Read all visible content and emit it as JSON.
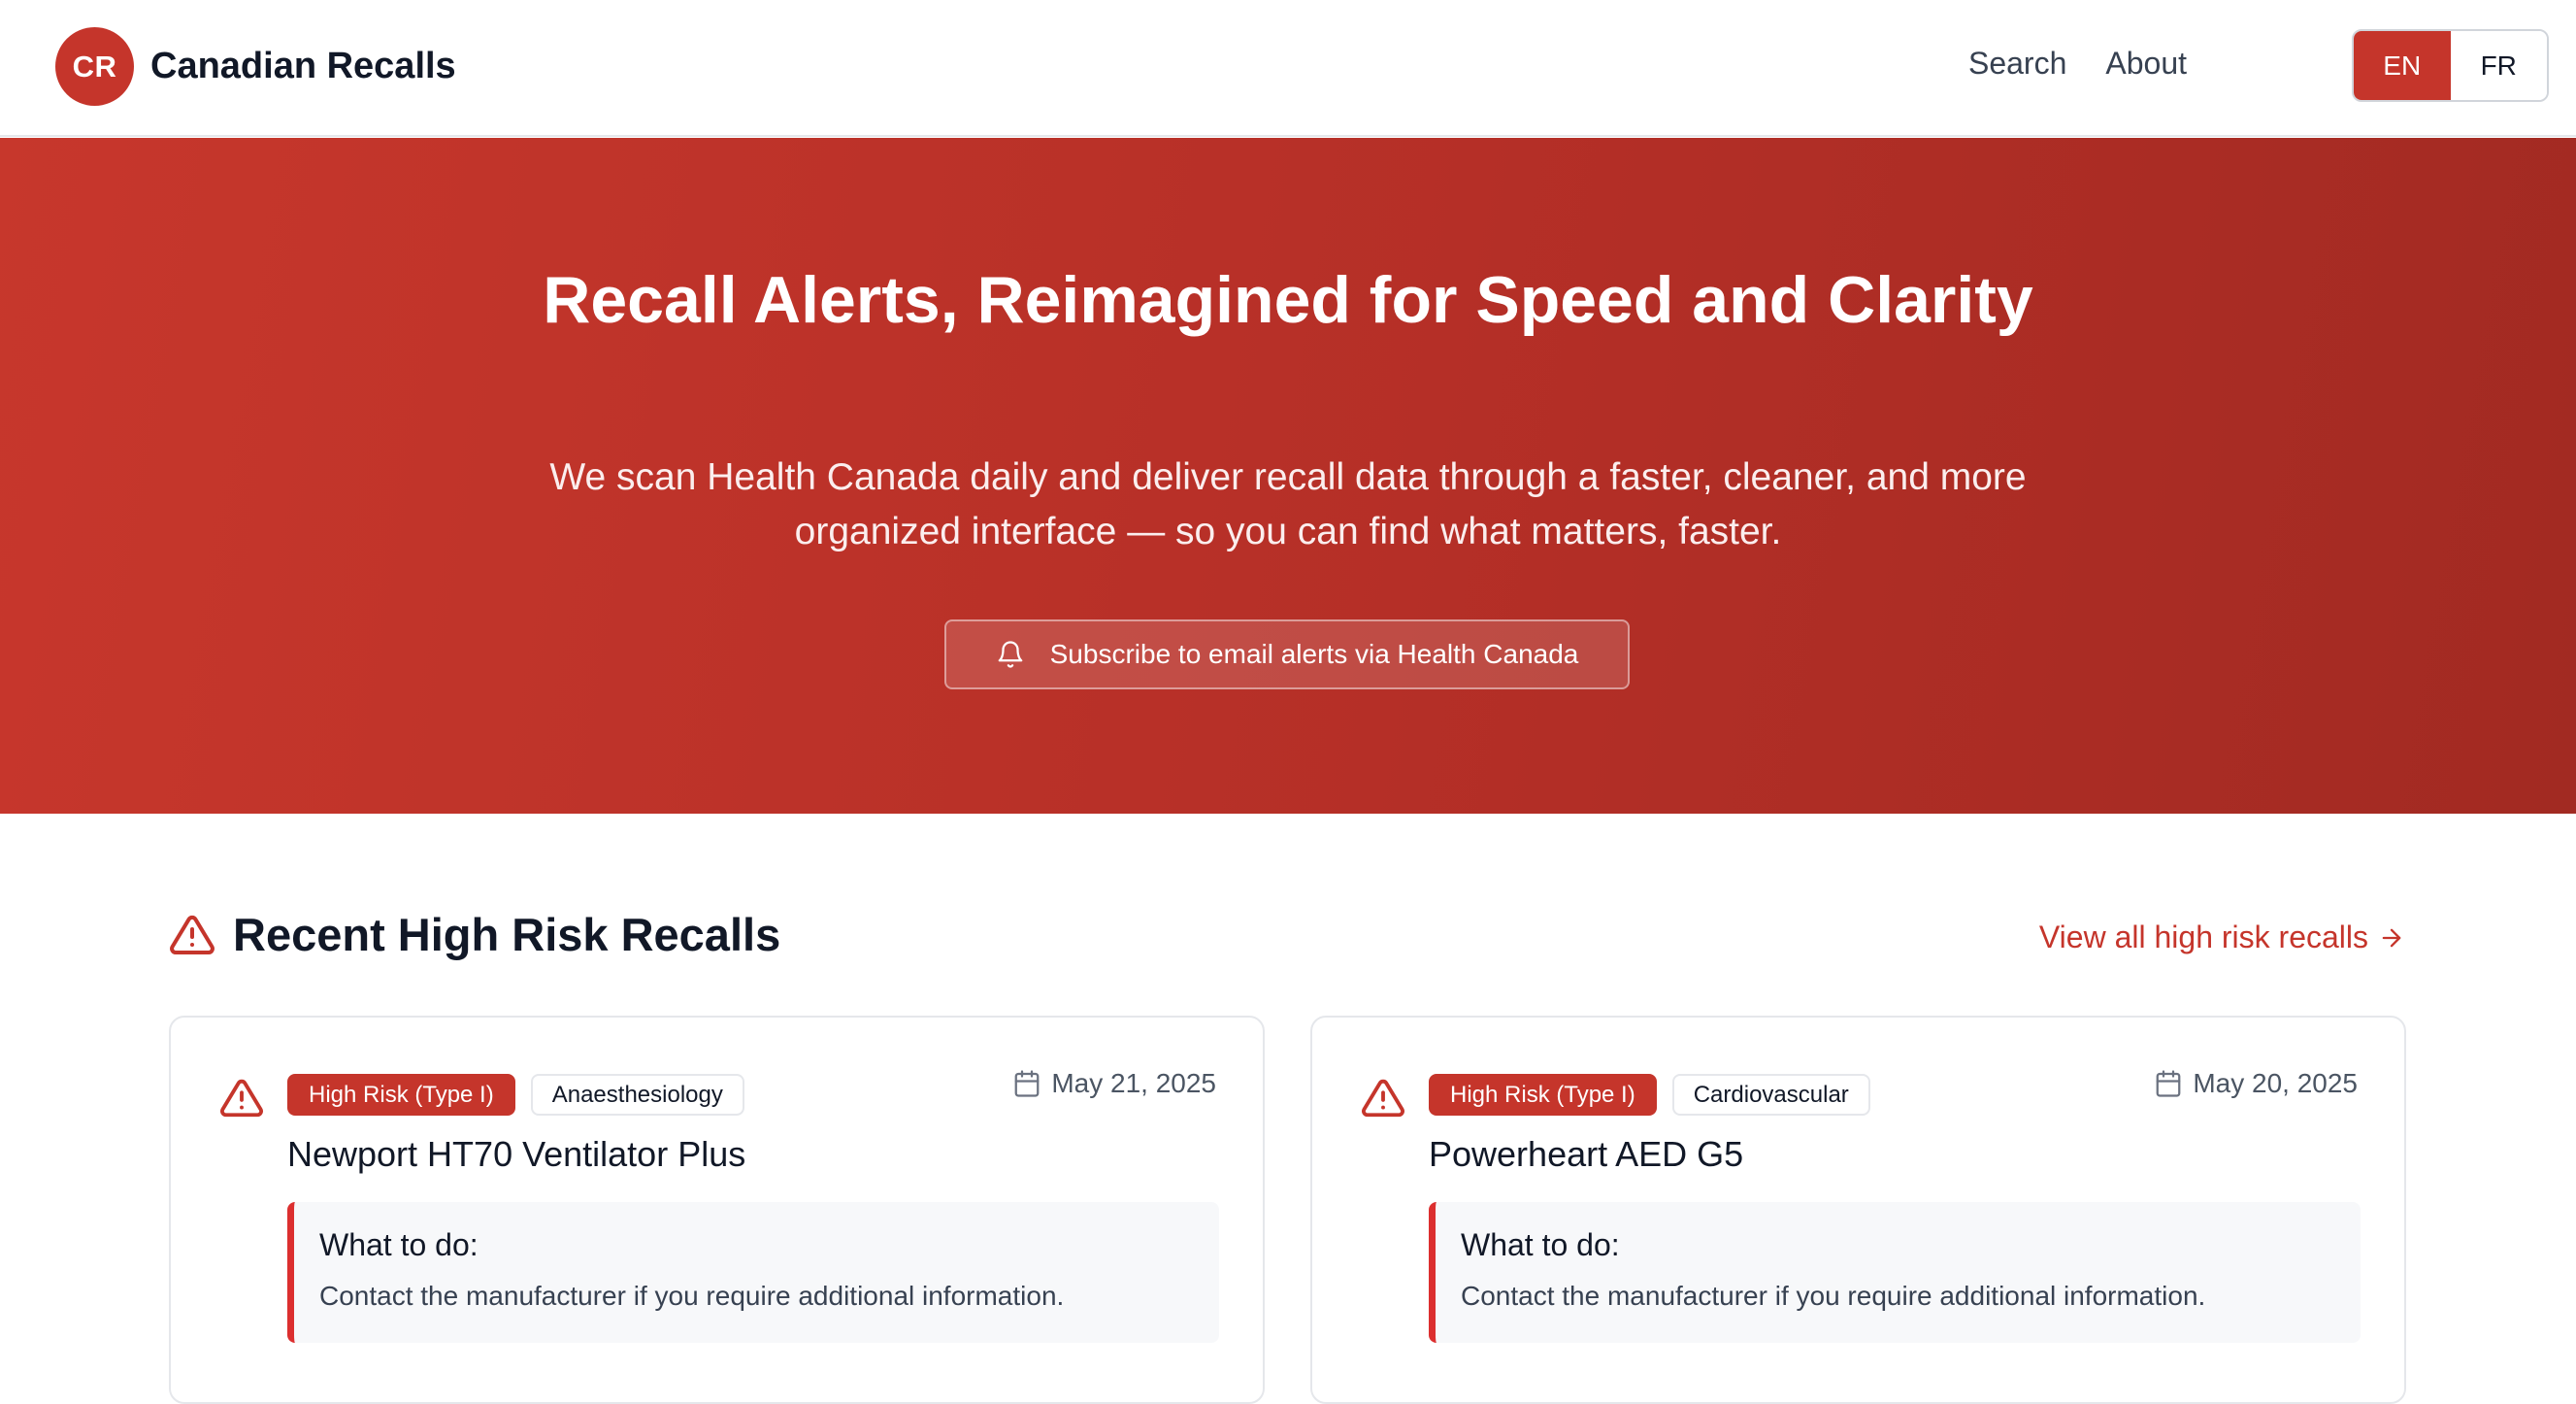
{
  "header": {
    "brand_initials": "CR",
    "brand_name": "Canadian Recalls",
    "nav": [
      "Search",
      "About"
    ],
    "lang": {
      "active": "EN",
      "inactive": "FR"
    }
  },
  "hero": {
    "title": "Recall Alerts, Reimagined for Speed and Clarity",
    "subtitle": "We scan Health Canada daily and deliver recall data through a faster, cleaner, and more organized interface — so you can find what matters, faster.",
    "subscribe_label": "Subscribe to email alerts via Health Canada"
  },
  "section": {
    "title": "Recent High Risk Recalls",
    "view_all": "View all high risk recalls"
  },
  "recalls": [
    {
      "risk": "High Risk (Type I)",
      "category": "Anaesthesiology",
      "date": "May 21, 2025",
      "title": "Newport HT70 Ventilator Plus",
      "todo_heading": "What to do:",
      "todo_text": "Contact the manufacturer if you require additional information."
    },
    {
      "risk": "High Risk (Type I)",
      "category": "Cardiovascular",
      "date": "May 20, 2025",
      "title": "Powerheart AED G5",
      "todo_heading": "What to do:",
      "todo_text": "Contact the manufacturer if you require additional information."
    }
  ],
  "colors": {
    "brand_red": "#c5352b",
    "hero_gradient_start": "#c7372c",
    "hero_gradient_end": "#a22a22",
    "todo_border": "#dc2f2f"
  },
  "icons": {
    "subscribe": "bell-icon",
    "section": "warning-triangle-icon",
    "view_all": "arrow-right-icon",
    "card_risk": "warning-triangle-icon",
    "card_date": "calendar-icon"
  }
}
